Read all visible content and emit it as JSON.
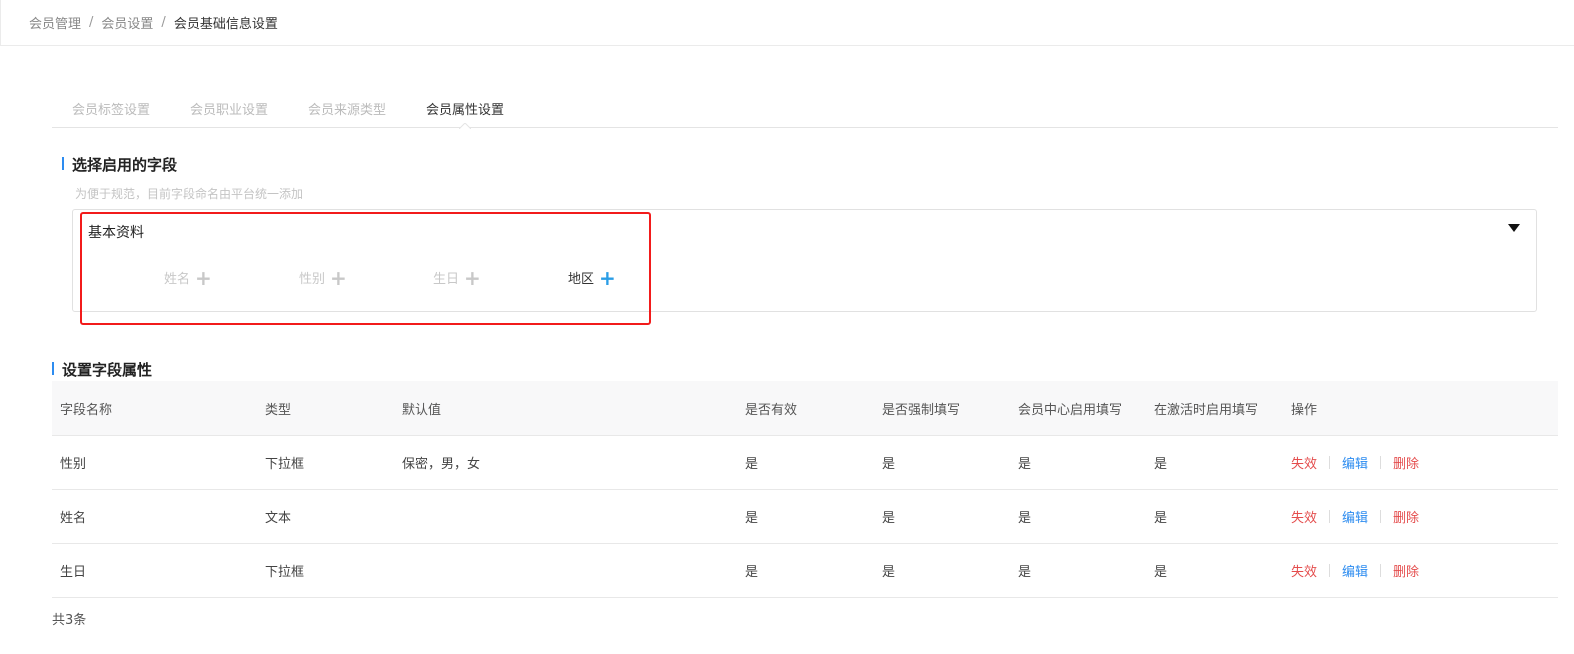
{
  "breadcrumb": {
    "items": [
      "会员管理",
      "会员设置",
      "会员基础信息设置"
    ],
    "separator": "/"
  },
  "tabs": [
    {
      "label": "会员标签设置",
      "active": false
    },
    {
      "label": "会员职业设置",
      "active": false
    },
    {
      "label": "会员来源类型",
      "active": false
    },
    {
      "label": "会员属性设置",
      "active": true
    }
  ],
  "field_section": {
    "title": "选择启用的字段",
    "hint": "为便于规范，目前字段命名由平台统一添加",
    "group_name": "基本资料",
    "add_icon": "+",
    "fields": [
      {
        "label": "姓名",
        "available": false
      },
      {
        "label": "性别",
        "available": false
      },
      {
        "label": "生日",
        "available": false
      },
      {
        "label": "地区",
        "available": true
      }
    ]
  },
  "attr_section": {
    "title": "设置字段属性"
  },
  "table": {
    "columns": [
      "字段名称",
      "类型",
      "默认值",
      "是否有效",
      "是否强制填写",
      "会员中心启用填写",
      "在激活时启用填写",
      "操作"
    ],
    "rows": [
      {
        "name": "性别",
        "type": "下拉框",
        "default": "保密，男，女",
        "valid": "是",
        "required": "是",
        "center_fill": "是",
        "activate_fill": "是"
      },
      {
        "name": "姓名",
        "type": "文本",
        "default": "",
        "valid": "是",
        "required": "是",
        "center_fill": "是",
        "activate_fill": "是"
      },
      {
        "name": "生日",
        "type": "下拉框",
        "default": "",
        "valid": "是",
        "required": "是",
        "center_fill": "是",
        "activate_fill": "是"
      }
    ],
    "actions": {
      "disable": "失效",
      "edit": "编辑",
      "delete": "删除"
    }
  },
  "footer": {
    "total": "共3条"
  },
  "colors": {
    "accent": "#2d8cf0",
    "danger": "#e44c4c",
    "highlight": "#f21b1b",
    "add_available": "#2a9de6"
  }
}
